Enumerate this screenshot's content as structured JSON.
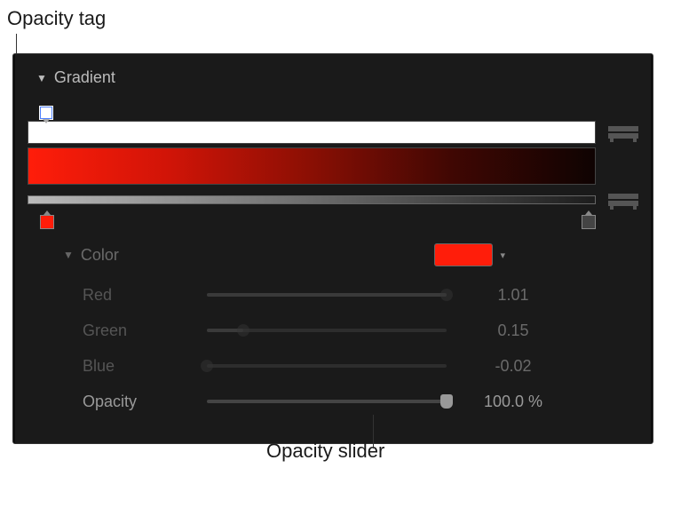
{
  "annotations": {
    "opacity_tag": "Opacity tag",
    "opacity_slider": "Opacity slider"
  },
  "panel": {
    "section_title": "Gradient",
    "color_section": {
      "title": "Color",
      "swatch_color": "#ff1d0a",
      "params": {
        "red": {
          "label": "Red",
          "value": "1.01",
          "pos": 100
        },
        "green": {
          "label": "Green",
          "value": "0.15",
          "pos": 15
        },
        "blue": {
          "label": "Blue",
          "value": "-0.02",
          "pos": 0
        },
        "opacity": {
          "label": "Opacity",
          "value": "100.0 %",
          "pos": 100
        }
      }
    }
  }
}
